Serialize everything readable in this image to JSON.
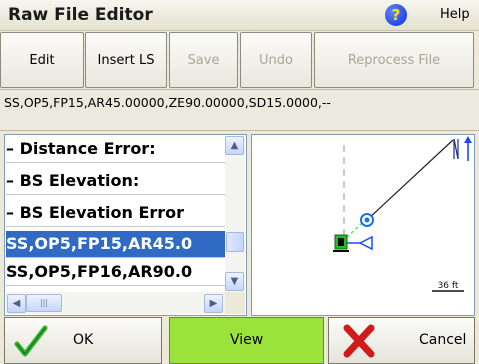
{
  "window": {
    "title": "Raw File Editor",
    "help_label": "Help",
    "help_icon": "help-icon"
  },
  "toolbar": {
    "edit": "Edit",
    "insert_ls": "Insert LS",
    "save": "Save",
    "undo": "Undo",
    "reprocess": "Reprocess File"
  },
  "record": "SS,OP5,FP15,AR45.00000,ZE90.00000,SD15.0000,--",
  "list": {
    "items": [
      "– Distance Error:",
      "– BS Elevation:",
      "– BS Elevation Error",
      "SS,OP5,FP15,AR45.0",
      "SS,OP5,FP16,AR90.0"
    ],
    "selected_index": 3
  },
  "view": {
    "scale_label": "36 ft"
  },
  "buttons": {
    "ok": "OK",
    "view": "View",
    "cancel": "Cancel"
  },
  "colors": {
    "selection": "#316ac5",
    "view_button": "#9be23b",
    "ok_check": "#2fb52f",
    "cancel_x": "#d11b1b"
  }
}
